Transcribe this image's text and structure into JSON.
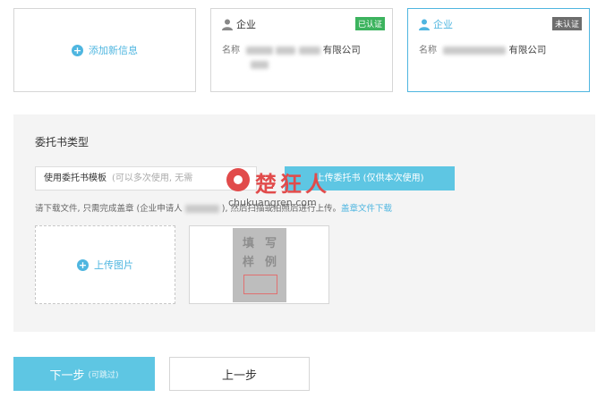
{
  "cards": {
    "add": {
      "label": "添加新信息"
    },
    "items": [
      {
        "type": "企业",
        "badge": "已认证",
        "badge_color": "#3cb35e",
        "name_label": "名称",
        "name_visible": "有限公司"
      },
      {
        "type": "企业",
        "badge": "未认证",
        "badge_color": "#6d6d6d",
        "name_label": "名称",
        "name_visible": "有限公司"
      }
    ]
  },
  "section": {
    "title": "委托书类型",
    "template_button": {
      "label": "使用委托书模板",
      "hint": "(可以多次使用, 无需"
    },
    "upload_button": {
      "label": "上传委托书 (仅供本次使用)"
    },
    "notice": "请下载文件, 只需完成盖章 (企业申请人",
    "notice_tail": "), 然后扫描或拍照后进行上传。",
    "notice_link": "盖章文件下载",
    "upload_image_label": "上传图片",
    "sample_chars": [
      "填",
      "写",
      "样",
      "例"
    ]
  },
  "footer": {
    "next_label": "下一步",
    "next_sub": "(可跳过)",
    "prev_label": "上一步"
  },
  "watermark": {
    "text": "楚狂人",
    "url": "chukuangren.com"
  },
  "colors": {
    "accent": "#4fb6e0",
    "button": "#5ec6e3",
    "watermark": "#e14b4b"
  }
}
